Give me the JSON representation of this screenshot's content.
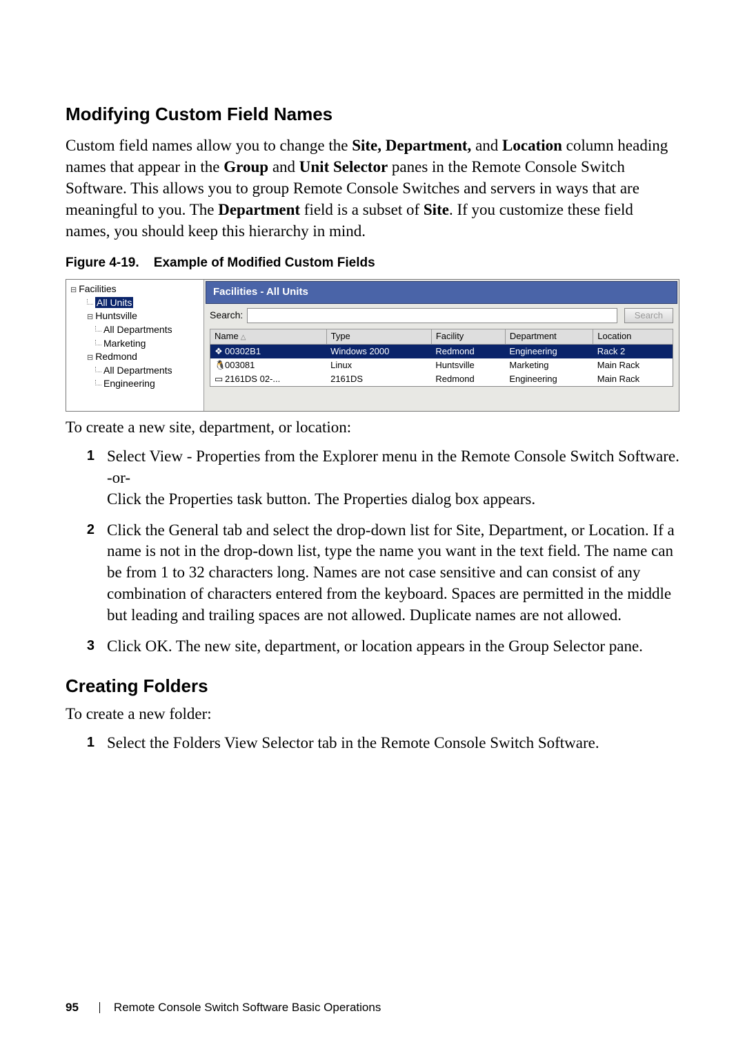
{
  "section1": {
    "heading": "Modifying Custom Field Names",
    "para_parts": [
      {
        "t": "Custom field names allow you to change the ",
        "b": false
      },
      {
        "t": "Site, Department,",
        "b": true
      },
      {
        "t": " and ",
        "b": false
      },
      {
        "t": "Location",
        "b": true
      },
      {
        "t": " column heading names that appear in the ",
        "b": false
      },
      {
        "t": "Group",
        "b": true
      },
      {
        "t": " and ",
        "b": false
      },
      {
        "t": "Unit Selector",
        "b": true
      },
      {
        "t": " panes in the Remote Console Switch Software. This allows you to group Remote Console Switches and servers in ways that are meaningful to you. The ",
        "b": false
      },
      {
        "t": "Department",
        "b": true
      },
      {
        "t": " field is a subset of ",
        "b": false
      },
      {
        "t": "Site",
        "b": true
      },
      {
        "t": ". If you customize these field names, you should keep this hierarchy in mind.",
        "b": false
      }
    ]
  },
  "figure": {
    "caption_prefix": "Figure 4-19.",
    "caption_title": "Example of Modified Custom Fields"
  },
  "screenshot": {
    "tree": [
      {
        "label": "Facilities",
        "level": 0,
        "expandable": true,
        "selected": false
      },
      {
        "label": "All Units",
        "level": 1,
        "expandable": false,
        "selected": true
      },
      {
        "label": "Huntsville",
        "level": 1,
        "expandable": true,
        "selected": false
      },
      {
        "label": "All Departments",
        "level": 2,
        "expandable": false,
        "selected": false
      },
      {
        "label": "Marketing",
        "level": 2,
        "expandable": false,
        "selected": false
      },
      {
        "label": "Redmond",
        "level": 1,
        "expandable": true,
        "selected": false
      },
      {
        "label": "All Departments",
        "level": 2,
        "expandable": false,
        "selected": false
      },
      {
        "label": "Engineering",
        "level": 2,
        "expandable": false,
        "selected": false
      }
    ],
    "panel_title": "Facilities - All Units",
    "search_label": "Search:",
    "search_button": "Search",
    "columns": [
      "Name",
      "Type",
      "Facility",
      "Department",
      "Location"
    ],
    "rows": [
      {
        "icon": "win",
        "name": "00302B1",
        "type": "Windows 2000",
        "facility": "Redmond",
        "department": "Engineering",
        "location": "Rack 2",
        "selected": true
      },
      {
        "icon": "linux",
        "name": "003081",
        "type": "Linux",
        "facility": "Huntsville",
        "department": "Marketing",
        "location": "Main Rack",
        "selected": false
      },
      {
        "icon": "switch",
        "name": "2161DS 02-...",
        "type": "2161DS",
        "facility": "Redmond",
        "department": "Engineering",
        "location": "Main Rack",
        "selected": false
      }
    ]
  },
  "afterfig_intro": "To create a new site, department, or location:",
  "steps1": [
    {
      "num": "1",
      "parts": [
        {
          "t": "Select ",
          "b": false
        },
        {
          "t": "View - Properties",
          "b": true
        },
        {
          "t": " from the Explorer menu in the Remote Console Switch Software.",
          "b": false
        }
      ],
      "extra": [
        {
          "sub_parts": [
            {
              "t": "-or-",
              "b": false
            }
          ]
        },
        {
          "sub_parts": [
            {
              "t": "Click the ",
              "b": false
            },
            {
              "t": "Properties",
              "b": true
            },
            {
              "t": " task button. The ",
              "b": false
            },
            {
              "t": "Properties",
              "b": true
            },
            {
              "t": " dialog box appears.",
              "b": false
            }
          ]
        }
      ]
    },
    {
      "num": "2",
      "parts": [
        {
          "t": "Click the ",
          "b": false
        },
        {
          "t": "General",
          "b": true
        },
        {
          "t": " tab and select the drop-down list for ",
          "b": false
        },
        {
          "t": "Site, Department,",
          "b": true
        },
        {
          "t": " or ",
          "b": false
        },
        {
          "t": "Location",
          "b": true
        },
        {
          "t": ". If a name is not in the drop-down list, type the name you want in the text field. The name can be from 1 to 32 characters long. Names are not case sensitive and can consist of any combination of characters entered from the keyboard. Spaces are permitted in the middle but leading and trailing spaces are not allowed. Duplicate names are not allowed.",
          "b": false
        }
      ],
      "extra": []
    },
    {
      "num": "3",
      "parts": [
        {
          "t": "Click ",
          "b": false
        },
        {
          "t": "OK",
          "b": true
        },
        {
          "t": ". The new site, department, or location appears in the ",
          "b": false
        },
        {
          "t": "Group Selector",
          "b": true
        },
        {
          "t": " pane.",
          "b": false
        }
      ],
      "extra": []
    }
  ],
  "section2": {
    "heading": "Creating Folders",
    "intro": "To create a new folder:"
  },
  "steps2": [
    {
      "num": "1",
      "parts": [
        {
          "t": "Select the ",
          "b": false
        },
        {
          "t": "Folders View Selector",
          "b": true
        },
        {
          "t": " tab in the Remote Console Switch Software.",
          "b": false
        }
      ],
      "extra": []
    }
  ],
  "footer": {
    "page": "95",
    "title": "Remote Console Switch Software Basic Operations"
  }
}
